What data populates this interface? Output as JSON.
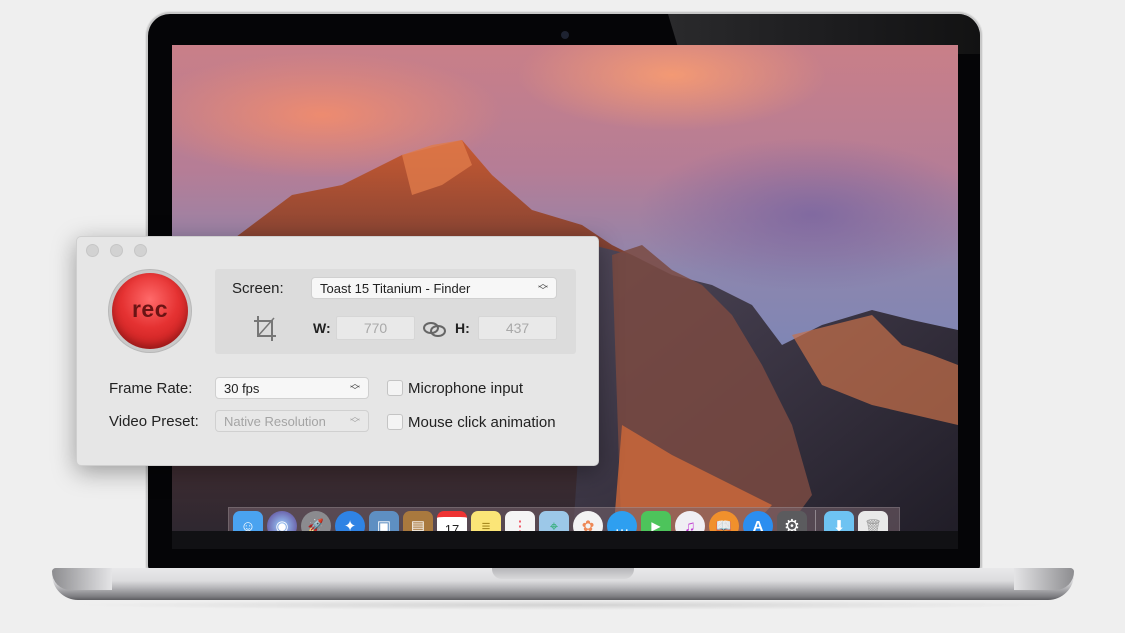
{
  "window": {
    "traffic_lights": [
      "close",
      "minimize",
      "zoom"
    ],
    "record_button": {
      "label": "rec",
      "icon": "record-icon"
    },
    "screen": {
      "label": "Screen:",
      "selected": "Toast 15 Titanium - Finder",
      "crop_icon": "crop-icon",
      "width_label": "W:",
      "width_value": "770",
      "link_icon": "link-icon",
      "height_label": "H:",
      "height_value": "437"
    },
    "frame_rate": {
      "label": "Frame Rate:",
      "selected": "30 fps"
    },
    "video_preset": {
      "label": "Video Preset:",
      "selected": "Native Resolution"
    },
    "options": [
      {
        "label": "Microphone input",
        "checked": false
      },
      {
        "label": "Mouse click animation",
        "checked": false
      }
    ]
  },
  "dock": {
    "apps": [
      {
        "name": "Finder",
        "icon": "finder-icon",
        "color": "#4aa3f0",
        "glyph": "☺"
      },
      {
        "name": "Siri",
        "icon": "siri-icon",
        "color": "#5a3b8c",
        "glyph": "◉"
      },
      {
        "name": "Launchpad",
        "icon": "launchpad-icon",
        "color": "#8b8b8f",
        "glyph": "🚀"
      },
      {
        "name": "Safari",
        "icon": "safari-icon",
        "color": "#2f83e4",
        "glyph": "✦"
      },
      {
        "name": "Preview",
        "icon": "preview-icon",
        "color": "#5e8fc2",
        "glyph": "▣"
      },
      {
        "name": "Contacts",
        "icon": "contacts-icon",
        "color": "#a9793e",
        "glyph": "▤"
      },
      {
        "name": "Calendar",
        "icon": "calendar-icon",
        "color": "#ffffff",
        "glyph": "17"
      },
      {
        "name": "Notes",
        "icon": "notes-icon",
        "color": "#fbe577",
        "glyph": "≡"
      },
      {
        "name": "Reminders",
        "icon": "reminders-icon",
        "color": "#f5f5f5",
        "glyph": "⋮"
      },
      {
        "name": "Maps",
        "icon": "maps-icon",
        "color": "#9cc8e8",
        "glyph": "⌖"
      },
      {
        "name": "Photos",
        "icon": "photos-icon",
        "color": "#f3f3f3",
        "glyph": "✿"
      },
      {
        "name": "Messages",
        "icon": "messages-icon",
        "color": "#2e9ff0",
        "glyph": "…"
      },
      {
        "name": "FaceTime",
        "icon": "facetime-icon",
        "color": "#4dc45b",
        "glyph": "▶"
      },
      {
        "name": "iTunes",
        "icon": "itunes-icon",
        "color": "#f0eef4",
        "glyph": "♫"
      },
      {
        "name": "iBooks",
        "icon": "ibooks-icon",
        "color": "#f0902c",
        "glyph": "📖"
      },
      {
        "name": "App Store",
        "icon": "app-store-icon",
        "color": "#2b8ef0",
        "glyph": "A"
      },
      {
        "name": "System Preferences",
        "icon": "system-preferences-icon",
        "color": "#5b5b5e",
        "glyph": "⚙"
      }
    ],
    "stacks": [
      {
        "name": "Downloads",
        "icon": "downloads-folder-icon",
        "color": "#6ec3f2",
        "glyph": "⬇"
      },
      {
        "name": "Trash",
        "icon": "trash-icon",
        "color": "#e9e9e9",
        "glyph": "🗑"
      }
    ]
  }
}
